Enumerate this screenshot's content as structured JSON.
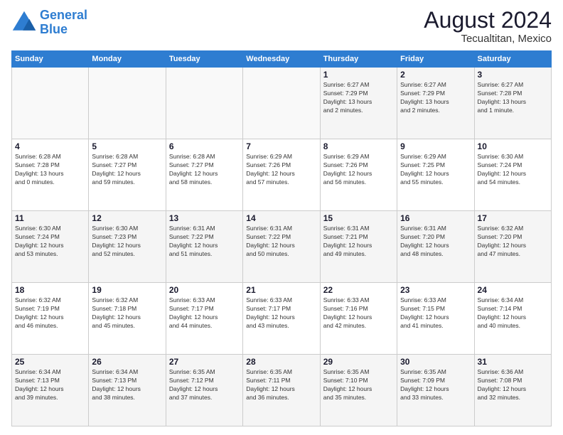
{
  "header": {
    "logo_line1": "General",
    "logo_line2": "Blue",
    "month": "August 2024",
    "location": "Tecualtitan, Mexico"
  },
  "days_of_week": [
    "Sunday",
    "Monday",
    "Tuesday",
    "Wednesday",
    "Thursday",
    "Friday",
    "Saturday"
  ],
  "weeks": [
    [
      {
        "day": "",
        "info": ""
      },
      {
        "day": "",
        "info": ""
      },
      {
        "day": "",
        "info": ""
      },
      {
        "day": "",
        "info": ""
      },
      {
        "day": "1",
        "info": "Sunrise: 6:27 AM\nSunset: 7:29 PM\nDaylight: 13 hours\nand 2 minutes."
      },
      {
        "day": "2",
        "info": "Sunrise: 6:27 AM\nSunset: 7:29 PM\nDaylight: 13 hours\nand 2 minutes."
      },
      {
        "day": "3",
        "info": "Sunrise: 6:27 AM\nSunset: 7:28 PM\nDaylight: 13 hours\nand 1 minute."
      }
    ],
    [
      {
        "day": "4",
        "info": "Sunrise: 6:28 AM\nSunset: 7:28 PM\nDaylight: 13 hours\nand 0 minutes."
      },
      {
        "day": "5",
        "info": "Sunrise: 6:28 AM\nSunset: 7:27 PM\nDaylight: 12 hours\nand 59 minutes."
      },
      {
        "day": "6",
        "info": "Sunrise: 6:28 AM\nSunset: 7:27 PM\nDaylight: 12 hours\nand 58 minutes."
      },
      {
        "day": "7",
        "info": "Sunrise: 6:29 AM\nSunset: 7:26 PM\nDaylight: 12 hours\nand 57 minutes."
      },
      {
        "day": "8",
        "info": "Sunrise: 6:29 AM\nSunset: 7:26 PM\nDaylight: 12 hours\nand 56 minutes."
      },
      {
        "day": "9",
        "info": "Sunrise: 6:29 AM\nSunset: 7:25 PM\nDaylight: 12 hours\nand 55 minutes."
      },
      {
        "day": "10",
        "info": "Sunrise: 6:30 AM\nSunset: 7:24 PM\nDaylight: 12 hours\nand 54 minutes."
      }
    ],
    [
      {
        "day": "11",
        "info": "Sunrise: 6:30 AM\nSunset: 7:24 PM\nDaylight: 12 hours\nand 53 minutes."
      },
      {
        "day": "12",
        "info": "Sunrise: 6:30 AM\nSunset: 7:23 PM\nDaylight: 12 hours\nand 52 minutes."
      },
      {
        "day": "13",
        "info": "Sunrise: 6:31 AM\nSunset: 7:22 PM\nDaylight: 12 hours\nand 51 minutes."
      },
      {
        "day": "14",
        "info": "Sunrise: 6:31 AM\nSunset: 7:22 PM\nDaylight: 12 hours\nand 50 minutes."
      },
      {
        "day": "15",
        "info": "Sunrise: 6:31 AM\nSunset: 7:21 PM\nDaylight: 12 hours\nand 49 minutes."
      },
      {
        "day": "16",
        "info": "Sunrise: 6:31 AM\nSunset: 7:20 PM\nDaylight: 12 hours\nand 48 minutes."
      },
      {
        "day": "17",
        "info": "Sunrise: 6:32 AM\nSunset: 7:20 PM\nDaylight: 12 hours\nand 47 minutes."
      }
    ],
    [
      {
        "day": "18",
        "info": "Sunrise: 6:32 AM\nSunset: 7:19 PM\nDaylight: 12 hours\nand 46 minutes."
      },
      {
        "day": "19",
        "info": "Sunrise: 6:32 AM\nSunset: 7:18 PM\nDaylight: 12 hours\nand 45 minutes."
      },
      {
        "day": "20",
        "info": "Sunrise: 6:33 AM\nSunset: 7:17 PM\nDaylight: 12 hours\nand 44 minutes."
      },
      {
        "day": "21",
        "info": "Sunrise: 6:33 AM\nSunset: 7:17 PM\nDaylight: 12 hours\nand 43 minutes."
      },
      {
        "day": "22",
        "info": "Sunrise: 6:33 AM\nSunset: 7:16 PM\nDaylight: 12 hours\nand 42 minutes."
      },
      {
        "day": "23",
        "info": "Sunrise: 6:33 AM\nSunset: 7:15 PM\nDaylight: 12 hours\nand 41 minutes."
      },
      {
        "day": "24",
        "info": "Sunrise: 6:34 AM\nSunset: 7:14 PM\nDaylight: 12 hours\nand 40 minutes."
      }
    ],
    [
      {
        "day": "25",
        "info": "Sunrise: 6:34 AM\nSunset: 7:13 PM\nDaylight: 12 hours\nand 39 minutes."
      },
      {
        "day": "26",
        "info": "Sunrise: 6:34 AM\nSunset: 7:13 PM\nDaylight: 12 hours\nand 38 minutes."
      },
      {
        "day": "27",
        "info": "Sunrise: 6:35 AM\nSunset: 7:12 PM\nDaylight: 12 hours\nand 37 minutes."
      },
      {
        "day": "28",
        "info": "Sunrise: 6:35 AM\nSunset: 7:11 PM\nDaylight: 12 hours\nand 36 minutes."
      },
      {
        "day": "29",
        "info": "Sunrise: 6:35 AM\nSunset: 7:10 PM\nDaylight: 12 hours\nand 35 minutes."
      },
      {
        "day": "30",
        "info": "Sunrise: 6:35 AM\nSunset: 7:09 PM\nDaylight: 12 hours\nand 33 minutes."
      },
      {
        "day": "31",
        "info": "Sunrise: 6:36 AM\nSunset: 7:08 PM\nDaylight: 12 hours\nand 32 minutes."
      }
    ]
  ]
}
